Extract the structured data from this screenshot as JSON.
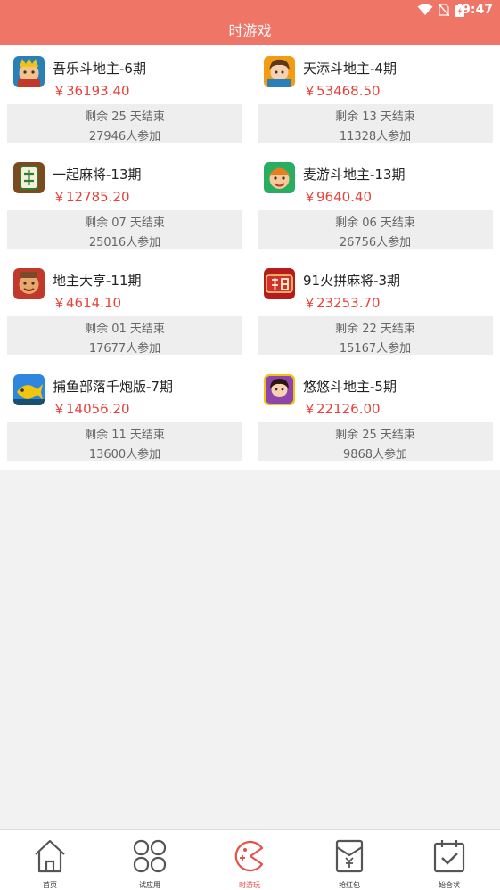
{
  "status_bar": {
    "time": "9:47"
  },
  "header": {
    "title": "时游戏"
  },
  "games": [
    {
      "title": "吾乐斗地主-6期",
      "prize": "￥36193.40",
      "remaining": "剩余 25 天结束",
      "participants": "27946人参加",
      "icon": "doudizhu-king-icon",
      "icon_color": "#c0392b"
    },
    {
      "title": "天添斗地主-4期",
      "prize": "￥53468.50",
      "remaining": "剩余 13 天结束",
      "participants": "11328人参加",
      "icon": "doudizhu-girl-icon",
      "icon_color": "#2980b9"
    },
    {
      "title": "一起麻将-13期",
      "prize": "￥12785.20",
      "remaining": "剩余 07 天结束",
      "participants": "25016人参加",
      "icon": "mahjong-tile-icon",
      "icon_color": "#8e5a2b"
    },
    {
      "title": "麦游斗地主-13期",
      "prize": "￥9640.40",
      "remaining": "剩余 06 天结束",
      "participants": "26756人参加",
      "icon": "doudizhu-boy-icon",
      "icon_color": "#27ae60"
    },
    {
      "title": "地主大亨-11期",
      "prize": "￥4614.10",
      "remaining": "剩余 01 天结束",
      "participants": "17677人参加",
      "icon": "landlord-tycoon-icon",
      "icon_color": "#7a4b2a"
    },
    {
      "title": "91火拼麻将-3期",
      "prize": "￥23253.70",
      "remaining": "剩余 22 天结束",
      "participants": "15167人参加",
      "icon": "mahjong-red-icon",
      "icon_color": "#c0392b"
    },
    {
      "title": "捕鱼部落千炮版-7期",
      "prize": "￥14056.20",
      "remaining": "剩余 11 天结束",
      "participants": "13600人参加",
      "icon": "fishing-icon",
      "icon_color": "#2e86de"
    },
    {
      "title": "悠悠斗地主-5期",
      "prize": "￥22126.00",
      "remaining": "剩余 25 天结束",
      "participants": "9868人参加",
      "icon": "doudizhu-lady-icon",
      "icon_color": "#8e44ad"
    }
  ],
  "tabs": [
    {
      "label": "首页",
      "icon": "home-icon",
      "active": false
    },
    {
      "label": "试应用",
      "icon": "apps-grid-icon",
      "active": false
    },
    {
      "label": "时游玩",
      "icon": "game-pacman-icon",
      "active": true
    },
    {
      "label": "抢红包",
      "icon": "red-envelope-icon",
      "active": false
    },
    {
      "label": "始合状",
      "icon": "calendar-check-icon",
      "active": false
    }
  ],
  "colors": {
    "accent": "#ef7566",
    "price": "#e8423a",
    "tab_active": "#e8504a"
  }
}
